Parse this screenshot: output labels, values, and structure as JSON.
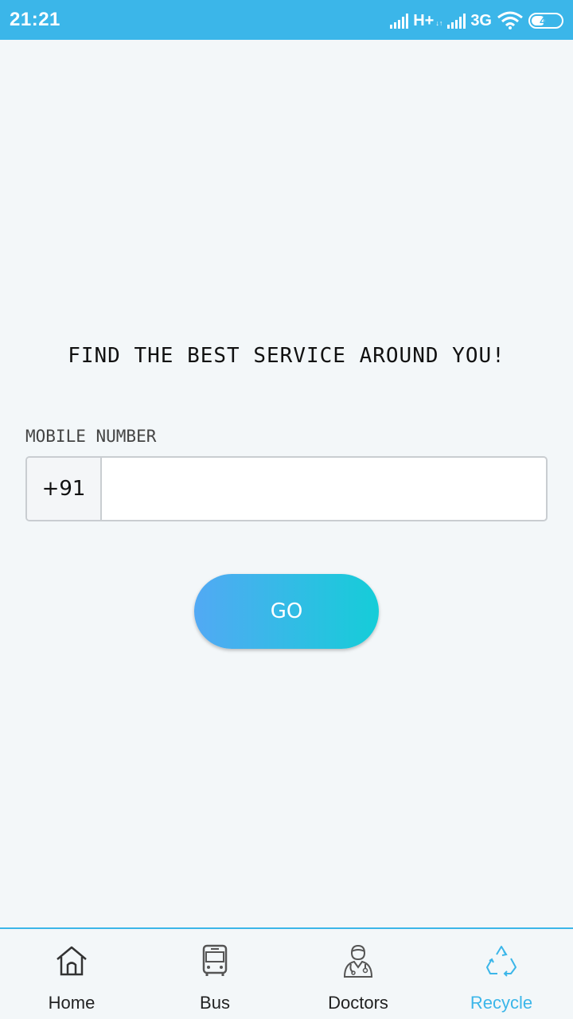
{
  "status_bar": {
    "time": "21:21",
    "network_1": "H+",
    "network_1_sub": "↓↑",
    "network_2": "3G",
    "battery": "46",
    "battery_level": 0.46
  },
  "main": {
    "headline": "FIND THE BEST SERVICE AROUND YOU!",
    "field_label": "MOBILE NUMBER",
    "country_code": "+91",
    "phone_value": "",
    "phone_placeholder": "",
    "go_label": "GO"
  },
  "bottom_nav": {
    "items": [
      {
        "label": "Home",
        "icon": "home-icon"
      },
      {
        "label": "Bus",
        "icon": "bus-icon"
      },
      {
        "label": "Doctors",
        "icon": "doctor-icon"
      },
      {
        "label": "Recycle",
        "icon": "recycle-icon"
      }
    ],
    "active": "Recycle"
  },
  "colors": {
    "accent": "#3bb6e9",
    "background": "#f3f7f9",
    "go_gradient_start": "#52a9f4",
    "go_gradient_end": "#15cdd8"
  }
}
